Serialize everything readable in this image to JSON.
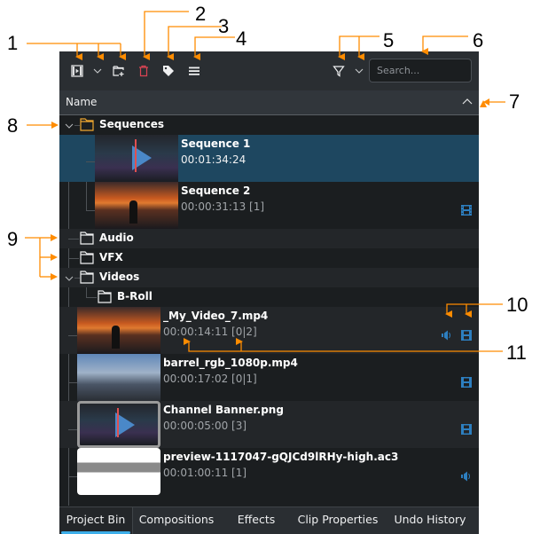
{
  "toolbar": {
    "buttons": [
      {
        "name": "add-clip",
        "icon": "add-clip-icon"
      },
      {
        "name": "add-clip-menu",
        "icon": "chevron-down-icon"
      },
      {
        "name": "create-folder",
        "icon": "folder-add-icon"
      },
      {
        "name": "delete",
        "icon": "trash-icon"
      },
      {
        "name": "tag",
        "icon": "tag-icon"
      },
      {
        "name": "menu",
        "icon": "hamburger-menu-icon"
      },
      {
        "name": "filter",
        "icon": "filter-icon"
      },
      {
        "name": "filter-menu",
        "icon": "chevron-down-icon"
      }
    ],
    "search_placeholder": "Search..."
  },
  "header": {
    "column": "Name",
    "sort_icon": "chevron-up-icon"
  },
  "tree": {
    "folders": {
      "sequences": "Sequences",
      "audio": "Audio",
      "vfx": "VFX",
      "videos": "Videos",
      "broll": "B-Roll"
    },
    "clips": [
      {
        "title": "Sequence 1",
        "info": "00:01:34:24",
        "thumb": "timeline",
        "selected": true,
        "icons": []
      },
      {
        "title": "Sequence 2",
        "info": "00:00:31:13 [1]",
        "thumb": "sunset",
        "selected": false,
        "icons": [
          "film-icon"
        ]
      },
      {
        "title": "_My_Video_7.mp4",
        "info": "00:00:14:11 [0|2]",
        "thumb": "sunset",
        "selected": false,
        "icons": [
          "audio-icon",
          "film-icon"
        ]
      },
      {
        "title": "barrel_rgb_1080p.mp4",
        "info": "00:00:17:02 [0|1]",
        "thumb": "city",
        "selected": false,
        "icons": [
          "film-icon"
        ]
      },
      {
        "title": "Channel Banner.png",
        "info": "00:00:05:00 [3]",
        "thumb": "timeline",
        "selected": false,
        "icons": [
          "film-icon"
        ]
      },
      {
        "title": "preview-1117047-gQJCd9lRHy-high.ac3",
        "info": "00:01:00:11 [1]",
        "thumb": "waveform",
        "selected": false,
        "icons": [
          "audio-icon"
        ]
      }
    ]
  },
  "tabs": [
    {
      "label": "Project Bin",
      "active": true
    },
    {
      "label": "Compositions",
      "active": false
    },
    {
      "label": "Effects",
      "active": false
    },
    {
      "label": "Clip Properties",
      "active": false
    },
    {
      "label": "Undo History",
      "active": false
    }
  ],
  "annotations": [
    "1",
    "2",
    "3",
    "4",
    "5",
    "6",
    "7",
    "8",
    "9",
    "10",
    "11"
  ],
  "colors": {
    "accent": "#3daee9",
    "selection": "#1e4760",
    "annotation": "#ff8c00",
    "delete": "#da4453",
    "folder_highlight": "#f0a830"
  }
}
